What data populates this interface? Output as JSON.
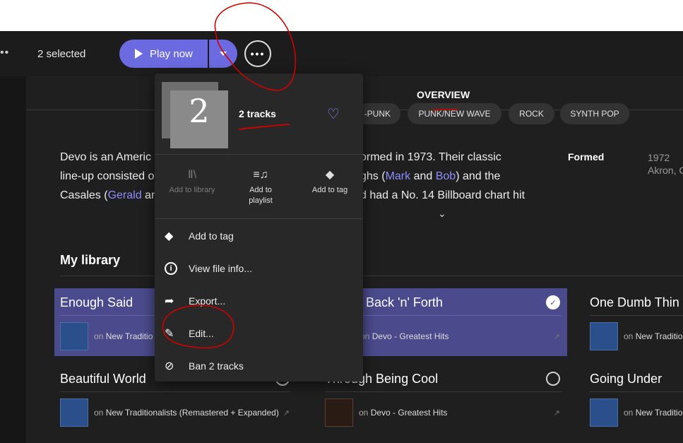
{
  "toolbar": {
    "left_dots": "••",
    "selected_count": "2 selected",
    "play_label": "Play now",
    "more_dots": "•••"
  },
  "tabs": {
    "overview": "OVERVIEW"
  },
  "chips": [
    "-PUNK",
    "PUNK/NEW WAVE",
    "ROCK",
    "SYNTH POP"
  ],
  "bio": {
    "line1_a": "Devo is an Americ",
    "line1_b": "ormed in 1973. Their classic",
    "line2_a": "line-up consisted o",
    "line2_b": "ghs (",
    "link_mark": "Mark",
    "and": " and ",
    "link_bob": "Bob",
    "line2_c": ") and the",
    "line3_a": "Casales (",
    "link_gerald": "Gerald",
    "line3_b": " an",
    "line3_c": "d had a No. 14 Billboard chart hit",
    "expand_icon": "⌄"
  },
  "facts": {
    "formed_label": "Formed",
    "formed_year": "1972",
    "formed_place": "Akron, C"
  },
  "library": {
    "heading": "My library",
    "tracks": [
      {
        "title": "Enough Said",
        "on": "on",
        "album": "New Traditio"
      },
      {
        "title": "Back 'n' Forth",
        "on": "on",
        "album": "Devo - Greatest Hits"
      },
      {
        "title": "One Dumb Thin",
        "on": "on",
        "album": "New Traditio"
      },
      {
        "title": "Beautiful World",
        "on": "on",
        "album": "New Traditionalists (Remastered + Expanded)"
      },
      {
        "title": "Through Being Cool",
        "on": "on",
        "album": "Devo - Greatest Hits"
      },
      {
        "title": "Going Under",
        "on": "on",
        "album": "New Traditio"
      }
    ],
    "check_glyph": "✓",
    "pin_glyph": "↗"
  },
  "menu": {
    "art_number": "2",
    "title": "2 tracks",
    "heart": "♡",
    "quick_actions": [
      {
        "label": "Add to library",
        "icon": "Ⅱ\\"
      },
      {
        "label": "Add to playlist",
        "icon": "≡♫"
      },
      {
        "label": "Add to tag",
        "icon": "◆"
      }
    ],
    "items": [
      {
        "label": "Add to tag",
        "icon": "◆"
      },
      {
        "label": "View file info...",
        "icon": "i"
      },
      {
        "label": "Export...",
        "icon": "➦"
      },
      {
        "label": "Edit...",
        "icon": "✎"
      },
      {
        "label": "Ban 2 tracks",
        "icon": "⊘"
      }
    ]
  },
  "colors": {
    "accent": "#6c6ae0",
    "selected_card": "#4b4a8c",
    "link": "#8f8cff",
    "annotation": "#d40000"
  }
}
